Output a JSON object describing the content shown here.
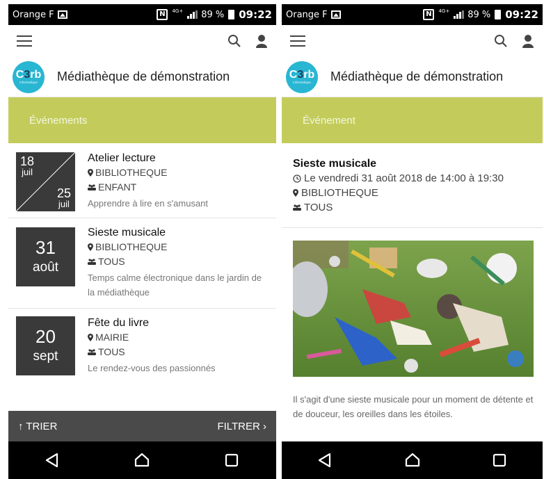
{
  "status_bar": {
    "carrier": "Orange F",
    "network": "4G+",
    "battery": "89 %",
    "time": "09:22"
  },
  "app": {
    "title": "Médiathèque de démonstration",
    "logo_text": "C3rb",
    "logo_subtext": "informatique"
  },
  "list_screen": {
    "section_title": "Événements",
    "events": [
      {
        "title": "Atelier lecture",
        "date_start_day": "18",
        "date_start_month": "juil",
        "date_end_day": "25",
        "date_end_month": "juil",
        "place": "BIBLIOTHEQUE",
        "audience": "ENFANT",
        "description": "Apprendre à lire en s'amusant"
      },
      {
        "title": "Sieste musicale",
        "date_day": "31",
        "date_month": "août",
        "place": "BIBLIOTHEQUE",
        "audience": "TOUS",
        "description": "Temps calme électronique dans le jardin de la médiathèque"
      },
      {
        "title": "Fête du livre",
        "date_day": "20",
        "date_month": "sept",
        "place": "MAIRIE",
        "audience": "TOUS",
        "description": "Le rendez-vous des passionnés"
      }
    ],
    "sort_label": "↑ TRIER",
    "filter_label": "FILTRER ›"
  },
  "detail_screen": {
    "section_title": "Événement",
    "title": "Sieste musicale",
    "datetime": "Le vendredi 31 août 2018 de 14:00 à 19:30",
    "place": "BIBLIOTHEQUE",
    "audience": "TOUS",
    "description": "Il s'agit d'une sieste musicale pour un moment de détente et de douceur, les oreilles dans les étoiles."
  },
  "colors": {
    "accent": "#c3cc5b",
    "logo": "#29b6d3",
    "date_box": "#3a3a3a",
    "sort_bar": "#4a4a4a"
  }
}
